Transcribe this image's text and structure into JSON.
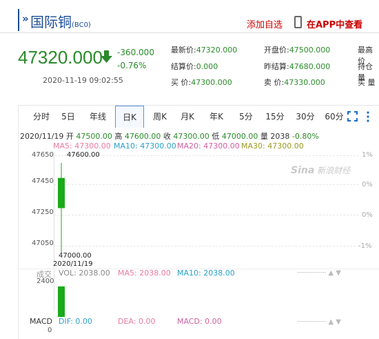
{
  "header": {
    "title": "国际铜",
    "code": "(BC0)",
    "add_watchlist": "添加自选",
    "view_in_app": "在APP中查看"
  },
  "quote": {
    "price": "47320.000",
    "change": "-360.000",
    "change_pct": "-0.76%",
    "timestamp": "2020-11-19 09:02:55",
    "fields": [
      {
        "label": "最新价:",
        "value": "47320.000"
      },
      {
        "label": "结算价:",
        "value": "0.000"
      },
      {
        "label": "买  价:",
        "value": "47300.000"
      },
      {
        "label": "开盘价:",
        "value": "47500.000"
      },
      {
        "label": "昨结算:",
        "value": "47680.000"
      },
      {
        "label": "卖  价:",
        "value": "47330.000"
      },
      {
        "label": "最高价",
        "value": ""
      },
      {
        "label": "持仓量",
        "value": ""
      },
      {
        "label": "买  量",
        "value": ""
      }
    ]
  },
  "tabs": [
    "分时",
    "5日",
    "年线",
    "日K",
    "周K",
    "月K",
    "年K",
    "5分",
    "15分",
    "30分",
    "60分"
  ],
  "active_tab": "日K",
  "ohlc": {
    "date": "2020/11/19",
    "open_label": "开",
    "open": "47500.00",
    "high_label": "高",
    "high": "47600.00",
    "close_label": "收",
    "close": "47300.00",
    "low_label": "低",
    "low": "47000.00",
    "vol_label": "量",
    "vol": "2038",
    "pct": "-0.80%"
  },
  "ma": {
    "ma5": "MA5: 47300.00",
    "ma10": "MA10: 47300.00",
    "ma20": "MA20: 47300.00",
    "ma30": "MA30: 47300.00"
  },
  "axes": {
    "price_ticks": [
      "47650",
      "47450",
      "47250",
      "47050"
    ],
    "pct_ticks": [
      "1%",
      "0%",
      "0%",
      "-1%"
    ],
    "high_label": "47600.00",
    "low_label": "47000.00",
    "date_label": "2020/11/19",
    "watermark_brand": "Sina",
    "watermark_text": "新浪财经"
  },
  "volume": {
    "title": "成交",
    "vol": "VOL: 2038.00",
    "ma5": "MA5: 2038.00",
    "ma10": "MA10: 2038.00",
    "tick": "2400"
  },
  "macd": {
    "title": "MACD",
    "dif": "DIF: 0.00",
    "dea": "DEA: 0.00",
    "macd": "MACD: 0.00",
    "tick": "0"
  },
  "colors": {
    "down": "#2a8a2a",
    "candle": "#1aaa1a",
    "ma5": "#e87aa0",
    "ma10": "#2aa0c8",
    "ma20": "#d060a0",
    "ma30": "#9a9a20",
    "accent": "#1a4c96",
    "action": "#cc0000"
  },
  "chart_data": {
    "type": "candlestick",
    "categories": [
      "2020/11/19"
    ],
    "open": [
      47500
    ],
    "high": [
      47600
    ],
    "low": [
      47000
    ],
    "close": [
      47300
    ],
    "volume": [
      2038
    ],
    "ylim": [
      47000,
      47700
    ]
  }
}
